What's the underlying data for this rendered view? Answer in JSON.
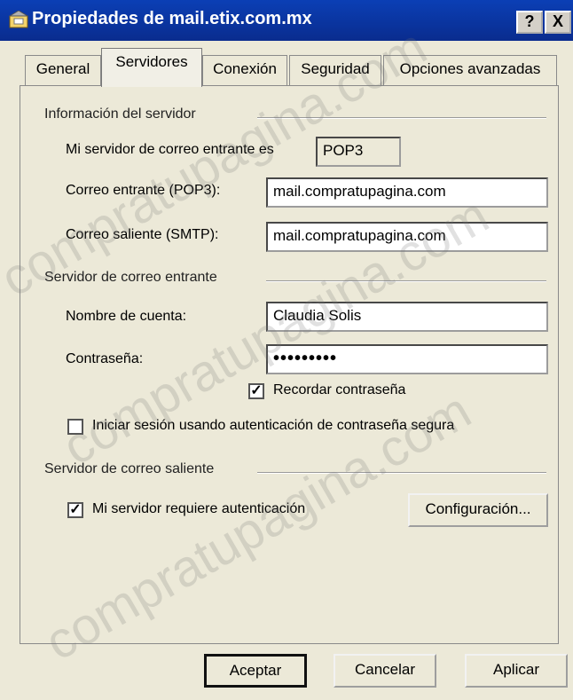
{
  "window": {
    "title": "Propiedades de mail.etix.com.mx",
    "help_label": "?",
    "close_label": "X"
  },
  "tabs": [
    {
      "label": "General",
      "active": false
    },
    {
      "label": "Servidores",
      "active": true
    },
    {
      "label": "Conexión",
      "active": false
    },
    {
      "label": "Seguridad",
      "active": false
    },
    {
      "label": "Opciones avanzadas",
      "active": false
    }
  ],
  "server_info": {
    "group_label": "Información del servidor",
    "incoming_type_label": "Mi servidor de correo entrante es",
    "incoming_type_value": "POP3",
    "incoming_label": "Correo entrante (POP3):",
    "incoming_value": "mail.compratupagina.com",
    "outgoing_label": "Correo saliente (SMTP):",
    "outgoing_value": "mail.compratupagina.com"
  },
  "incoming_server": {
    "group_label": "Servidor de correo entrante",
    "account_label": "Nombre de cuenta:",
    "account_value": "Claudia Solis",
    "password_label": "Contraseña:",
    "password_value": "•••••••••",
    "remember_label": "Recordar contraseña",
    "remember_checked": true,
    "secure_auth_label": "Iniciar sesión usando autenticación de contraseña segura",
    "secure_auth_checked": false
  },
  "outgoing_server": {
    "group_label": "Servidor de correo saliente",
    "requires_auth_label": "Mi servidor requiere autenticación",
    "requires_auth_checked": true,
    "settings_button": "Configuración..."
  },
  "footer": {
    "ok": "Aceptar",
    "cancel": "Cancelar",
    "apply": "Aplicar"
  },
  "watermark": "compratupagina.com",
  "colors": {
    "titlebar": "#0a2c8e",
    "dialog_bg": "#ece9d8"
  },
  "icons": {
    "title_icon": "mail-properties-icon",
    "check_mark": "✓"
  }
}
